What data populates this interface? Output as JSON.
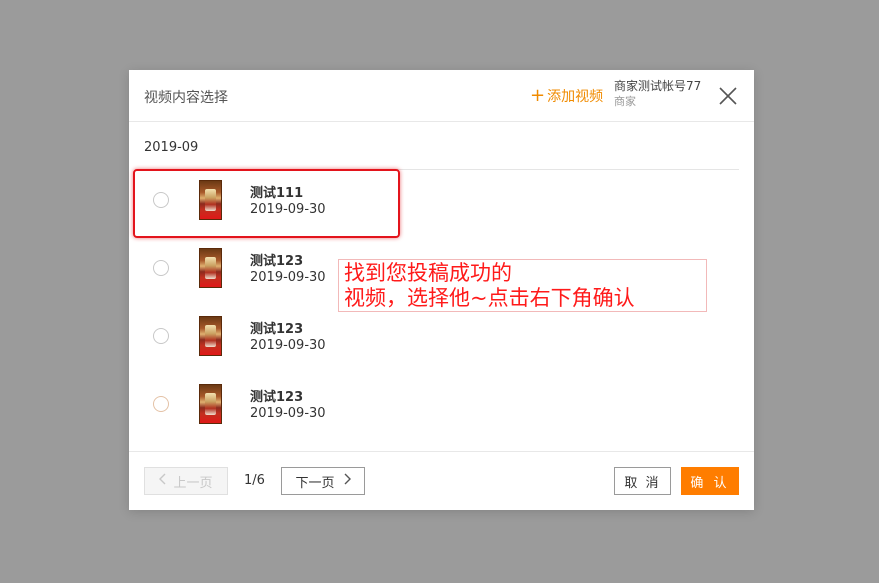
{
  "dialog": {
    "title": "视频内容选择",
    "add_video_label": "添加视频",
    "account_name": "商家测试帐号77",
    "account_role": "商家"
  },
  "group": {
    "date": "2019-09"
  },
  "items": [
    {
      "title": "测试111",
      "date": "2019-09-30"
    },
    {
      "title": "测试123",
      "date": "2019-09-30"
    },
    {
      "title": "测试123",
      "date": "2019-09-30"
    },
    {
      "title": "测试123",
      "date": "2019-09-30"
    }
  ],
  "annotation": {
    "line1": "找到您投稿成功的",
    "line2": "视频，选择他~点击右下角确认"
  },
  "footer": {
    "prev_label": "上一页",
    "page": "1/6",
    "next_label": "下一页",
    "cancel_label": "取 消",
    "confirm_label": "确 认"
  },
  "colors": {
    "accent": "#ff7d00",
    "add_link": "#f08b00",
    "annotation": "#ff1a1a"
  },
  "icons": {
    "add": "plus-icon",
    "close": "close-icon",
    "prev": "chevron-left-icon",
    "next": "chevron-right-icon"
  }
}
